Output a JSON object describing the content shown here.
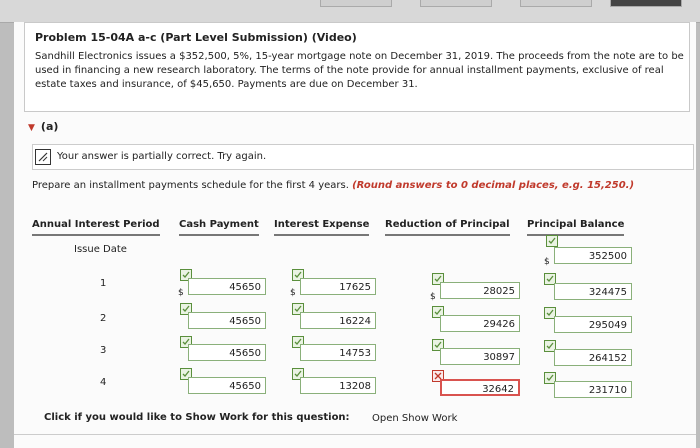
{
  "problem": {
    "title": "Problem 15-04A a-c (Part Level Submission) (Video)",
    "text": "Sandhill Electronics issues a $352,500, 5%, 15-year mortgage note on December 31, 2019. The proceeds from the note are to be used in financing a new research laboratory. The terms of the note provide for annual installment payments, exclusive of real estate taxes and insurance, of $45,650. Payments are due on December 31."
  },
  "part": {
    "label": "(a)"
  },
  "feedback": {
    "message": "Your answer is partially correct.  Try again."
  },
  "instructions": {
    "text": "Prepare an installment payments schedule for the first 4 years.",
    "rounding": "(Round answers to 0 decimal places, e.g. 15,250.)"
  },
  "table": {
    "headers": [
      "Annual Interest Period",
      "Cash Payment",
      "Interest Expense",
      "Reduction of Principal",
      "Principal Balance"
    ],
    "issue_label": "Issue Date",
    "issue_balance": "352500",
    "currency": "$",
    "rows": [
      {
        "period": "1",
        "cash": "45650",
        "interest": "17625",
        "reduction": "28025",
        "balance": "324475"
      },
      {
        "period": "2",
        "cash": "45650",
        "interest": "16224",
        "reduction": "29426",
        "balance": "295049"
      },
      {
        "period": "3",
        "cash": "45650",
        "interest": "14753",
        "reduction": "30897",
        "balance": "264152"
      },
      {
        "period": "4",
        "cash": "45650",
        "interest": "13208",
        "reduction": "32642",
        "balance": "231710"
      }
    ]
  },
  "footer": {
    "show_work_label": "Click if you would like to Show Work for this question:",
    "open_show_work": "Open Show Work"
  },
  "colors": {
    "correct_border": "#8ab07a",
    "incorrect_border": "#d9534f",
    "emphasis": "#c0392b"
  }
}
